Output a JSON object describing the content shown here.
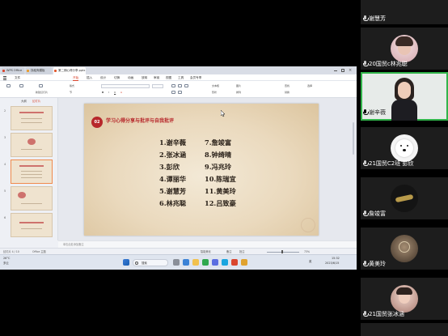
{
  "window": {
    "tabs": [
      {
        "label": "WPS Office"
      },
      {
        "label": "找稻壳模板"
      },
      {
        "label": "第二期心得分享.pptx",
        "active": true
      }
    ],
    "menu": [
      "文件",
      "开始",
      "插入",
      "设计",
      "切换",
      "动画",
      "放映",
      "审阅",
      "视图",
      "工具",
      "会员专享"
    ],
    "ribbon": {
      "new_slide": "新建幻灯片",
      "layout": "版式",
      "section": "节",
      "find": "查找",
      "replace": "替换",
      "select": "选择",
      "arrange": "排列",
      "shape": "形状",
      "textbox": "文本框",
      "picture": "图片"
    },
    "thumb_numbers": [
      "2",
      "3",
      "4",
      "5",
      "6"
    ],
    "panel_tabs": [
      "大纲",
      "幻灯片"
    ]
  },
  "slide": {
    "badge": "02",
    "title": "学习心得分享与批评与自我批评",
    "names_left": [
      "1.谢辛薇",
      "2.张冰涵",
      "3.彭欣",
      "4.谭丽华",
      "5.谢慧芳",
      "6.林兆聪"
    ],
    "names_right": [
      "7.詹竣富",
      "8.钟绮晴",
      "9.冯兆玲",
      "10.陈瑞宜",
      "11.黄美玲",
      "12.吕致豪"
    ]
  },
  "notes_placeholder": "单击此处添加备注",
  "status": {
    "slide_counter": "幻灯片 4 / 10",
    "theme": "Office 主题",
    "zoom": "73%",
    "smart_beauty": "智能美化",
    "notes": "备注",
    "comment": "批注"
  },
  "taskbar": {
    "search_placeholder": "搜索",
    "weather_temp": "26°C",
    "weather_desc": "多云",
    "time": "15:32",
    "date": "2023/6/15",
    "ime": "英"
  },
  "participants": [
    {
      "name": "谢慧芳",
      "muted": true,
      "type": "partial"
    },
    {
      "name": "20国贸c林兆聪",
      "muted": true,
      "type": "avatar",
      "color": "#e7c7c9"
    },
    {
      "name": "谢辛薇",
      "muted": false,
      "type": "video",
      "speaking": true
    },
    {
      "name": "21国贸C2班 彭欣",
      "muted": true,
      "type": "avatar",
      "color": "#f2f2f2"
    },
    {
      "name": "詹竣富",
      "muted": true,
      "type": "avatar",
      "color": "#2c2c2c"
    },
    {
      "name": "黄美玲",
      "muted": true,
      "type": "avatar",
      "color": "#5a4a3a"
    },
    {
      "name": "21国贸张冰涵",
      "muted": true,
      "type": "avatar",
      "color": "#c79a8a"
    }
  ]
}
